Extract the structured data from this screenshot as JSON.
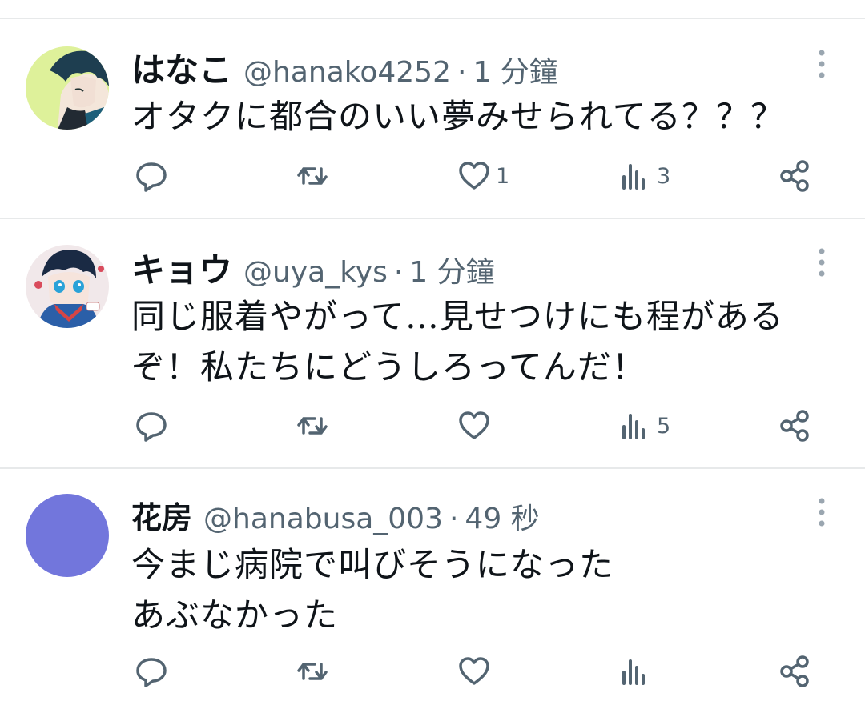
{
  "tweets": [
    {
      "name": "はなこ",
      "handle": "@hanako4252",
      "separator": "·",
      "time": "1 分鐘",
      "text_lines": [
        "オタクに都合のいい夢みせられてる？？？"
      ],
      "reply_count": "",
      "retweet_count": "",
      "like_count": "1",
      "view_count": "3",
      "avatar_icon": "anime-boy-avatar"
    },
    {
      "name": "キョウ",
      "handle": "@uya_kys",
      "separator": "·",
      "time": "1 分鐘",
      "text_lines": [
        "同じ服着やがって…見せつけにも程がある",
        "ぞ！私たちにどうしろってんだ！"
      ],
      "reply_count": "",
      "retweet_count": "",
      "like_count": "",
      "view_count": "5",
      "avatar_icon": "anime-character-avatar"
    },
    {
      "name": "花房",
      "handle": "@hanabusa_003",
      "separator": "·",
      "time": "49 秒",
      "text_lines": [
        "今まじ病院で叫びそうになった",
        "あぶなかった"
      ],
      "reply_count": "",
      "retweet_count": "",
      "like_count": "",
      "view_count": "",
      "avatar_icon": "solid-color-avatar",
      "avatar_color": "#7276dc"
    }
  ],
  "colors": {
    "text": "#0f1419",
    "secondary": "#536471",
    "divider": "#e7e9ea"
  },
  "icons": [
    "reply-icon",
    "retweet-icon",
    "like-icon",
    "views-icon",
    "share-icon",
    "more-icon"
  ]
}
